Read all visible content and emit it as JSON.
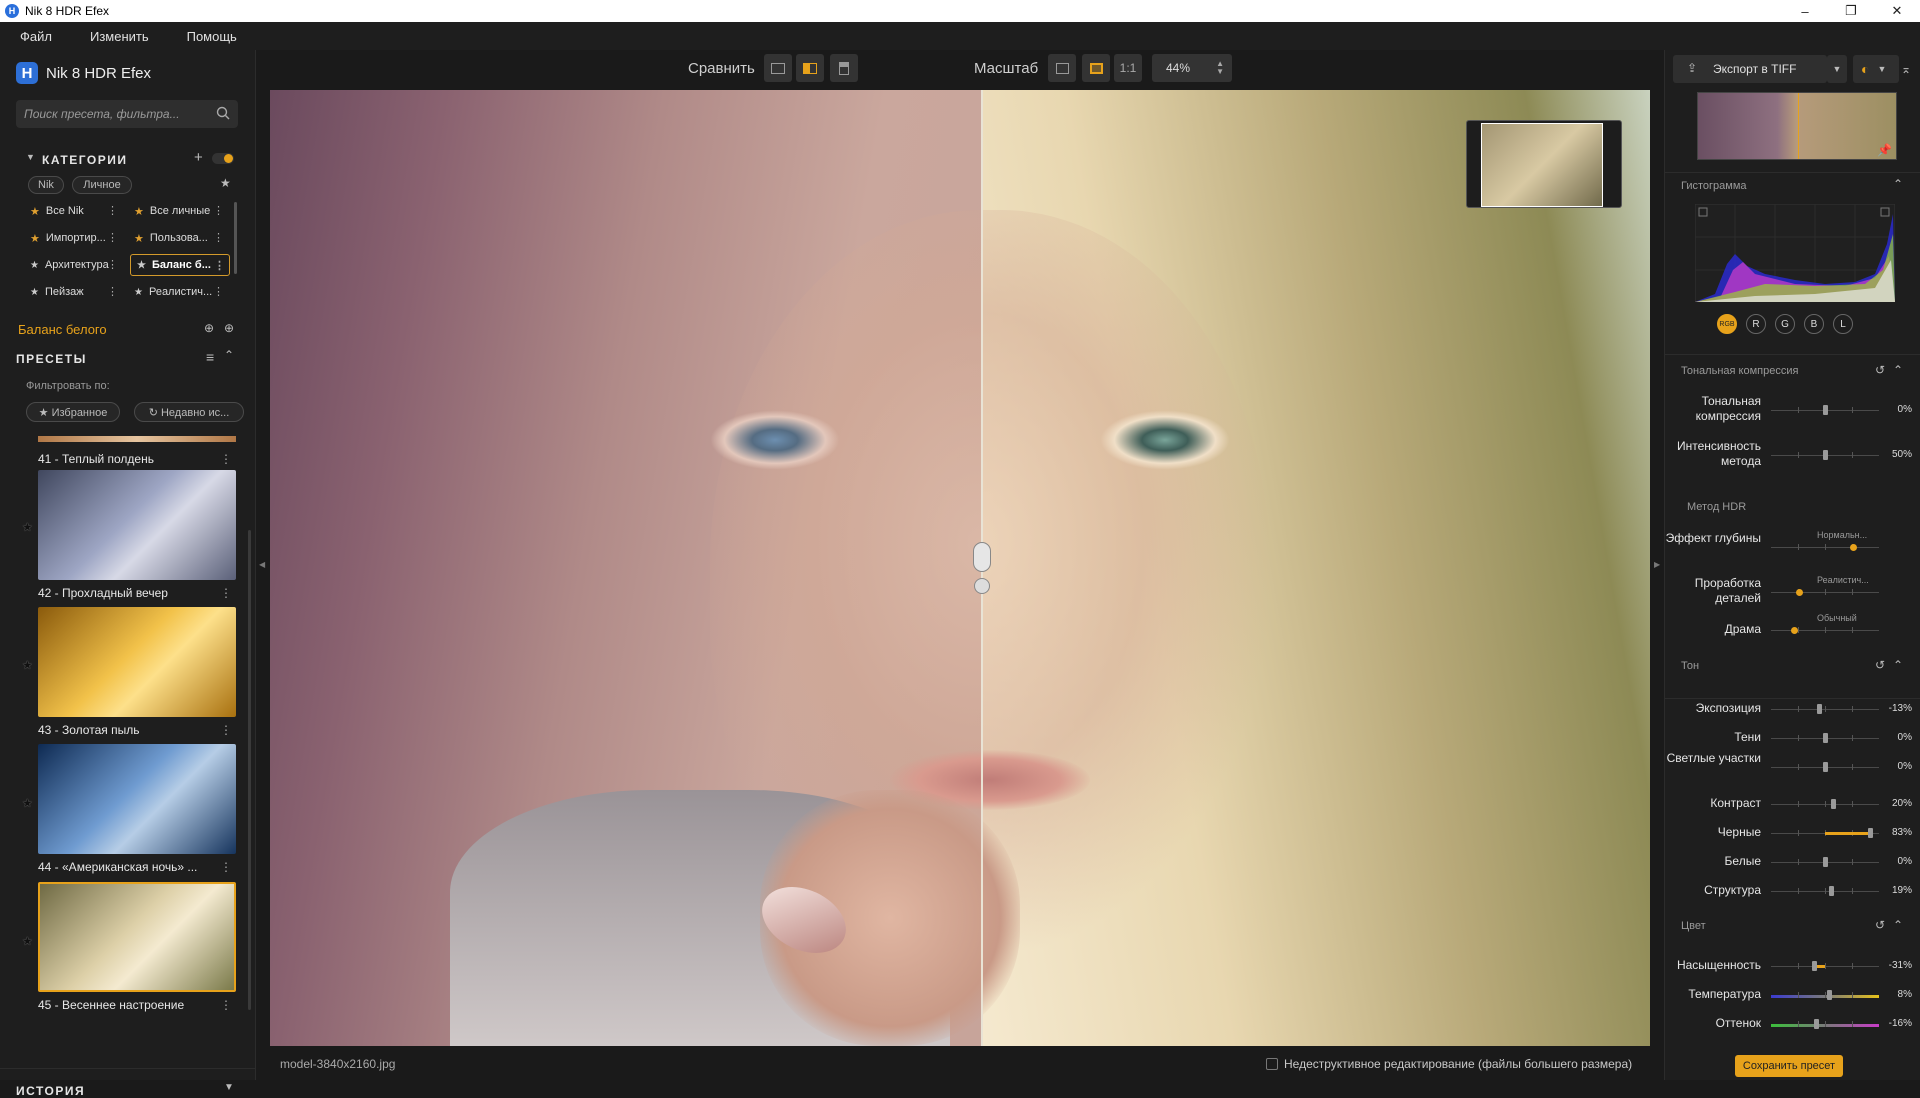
{
  "window": {
    "title": "Nik 8 HDR Efex",
    "min": "–",
    "max": "❐",
    "close": "✕"
  },
  "menu": [
    "Файл",
    "Изменить",
    "Помощь"
  ],
  "left": {
    "app_name": "Nik 8 HDR Efex",
    "search_placeholder": "Поиск пресета, фильтра...",
    "categories_title": "КАТЕГОРИИ",
    "chips": [
      "Nik",
      "Личное"
    ],
    "categories": [
      {
        "label": "Все Nik",
        "fav": true
      },
      {
        "label": "Все личные",
        "fav": true
      },
      {
        "label": "Импортир...",
        "fav": true
      },
      {
        "label": "Пользова...",
        "fav": true
      },
      {
        "label": "Архитектура",
        "fav": false
      },
      {
        "label": "Баланс б...",
        "fav": false,
        "selected": true
      },
      {
        "label": "Пейзаж",
        "fav": false
      },
      {
        "label": "Реалистич...",
        "fav": false
      }
    ],
    "current_category": "Баланс белого",
    "presets_title": "ПРЕСЕТЫ",
    "filter_by": "Фильтровать по:",
    "filter_favorites": "★ Избранное",
    "filter_recent": "↻ Недавно ис...",
    "presets": [
      {
        "label": "41 - Теплый полдень"
      },
      {
        "label": "42 - Прохладный вечер"
      },
      {
        "label": "43 - Золотая пыль"
      },
      {
        "label": "44 - «Американская ночь» ..."
      },
      {
        "label": "45 - Весеннее настроение"
      }
    ],
    "history_title": "ИСТОРИЯ"
  },
  "toolbar": {
    "compare_label": "Сравнить",
    "zoom_label": "Масштаб",
    "one_to_one": "1:1",
    "zoom_value": "44%"
  },
  "status": {
    "filename": "model-3840x2160.jpg",
    "nondestructive": "Недеструктивное редактирование (файлы большего размера)"
  },
  "right": {
    "export_label": "Экспорт в TIFF",
    "histogram_title": "Гистограмма",
    "hist_channels": [
      "RGB",
      "R",
      "G",
      "B",
      "L"
    ],
    "tonal_title": "Тональная компрессия",
    "hdr_method_title": "Метод HDR",
    "tone_title": "Тон",
    "color_title": "Цвет",
    "tonal": [
      {
        "label": "Тональная компрессия",
        "value": "0%",
        "level": 0.5
      },
      {
        "label": "Интенсивность метода",
        "value": "50%",
        "level": 0.5
      }
    ],
    "hdr": [
      {
        "label": "Эффект глубины",
        "caption": "Нормальн...",
        "level": 0.75
      },
      {
        "label": "Проработка деталей",
        "caption": "Реалистич...",
        "level": 0.25
      },
      {
        "label": "Драма",
        "caption": "Обычный",
        "level": 0.2
      }
    ],
    "tone": [
      {
        "label": "Экспозиция",
        "value": "-13%",
        "level": 0.44
      },
      {
        "label": "Тени",
        "value": "0%",
        "level": 0.5
      },
      {
        "label": "Светлые участки",
        "value": "0%",
        "level": 0.5
      },
      {
        "label": "Контраст",
        "value": "20%",
        "level": 0.57
      },
      {
        "label": "Черные",
        "value": "83%",
        "level": 0.92
      },
      {
        "label": "Белые",
        "value": "0%",
        "level": 0.5
      },
      {
        "label": "Структура",
        "value": "19%",
        "level": 0.56
      }
    ],
    "color": [
      {
        "label": "Насыщенность",
        "value": "-31%",
        "level": 0.4
      },
      {
        "label": "Температура",
        "value": "8%",
        "level": 0.54
      },
      {
        "label": "Оттенок",
        "value": "-16%",
        "level": 0.42
      }
    ],
    "save_preset": "Сохранить пресет"
  },
  "colors": {
    "accent": "#e7a21b",
    "brand": "#2d6fd6"
  }
}
